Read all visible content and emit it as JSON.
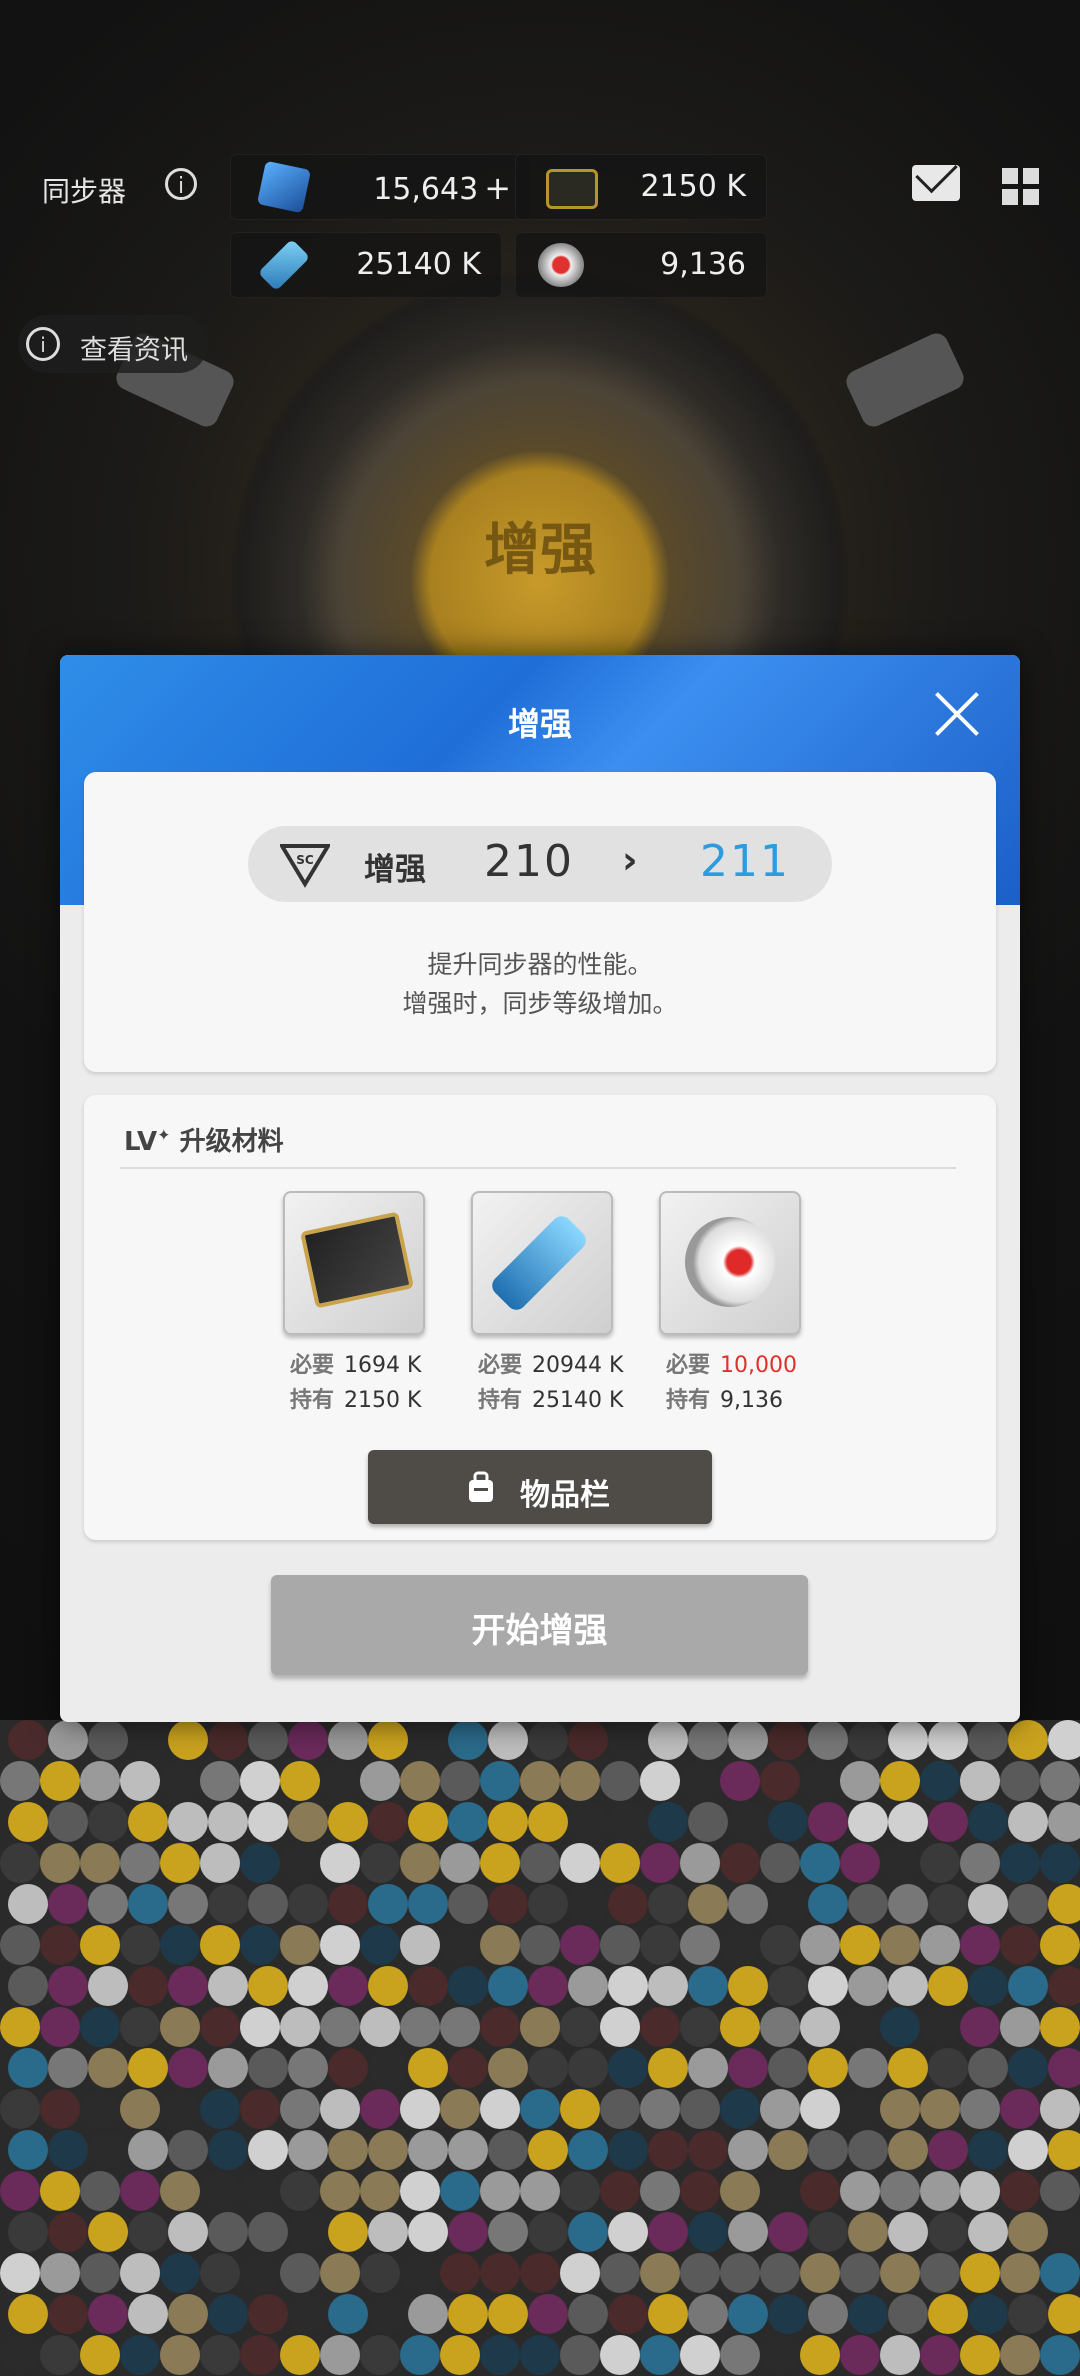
{
  "topbar": {
    "title": "同步器",
    "resources": [
      {
        "icon": "crystal-icon",
        "value": "15,643",
        "has_plus": true
      },
      {
        "icon": "core-card-icon",
        "value": "2150 K"
      },
      {
        "icon": "usb-drive-icon",
        "value": "25140 K"
      },
      {
        "icon": "module-orb-icon",
        "value": "9,136"
      }
    ],
    "info_label": "查看资讯"
  },
  "background": {
    "machine_label": "增强"
  },
  "dialog": {
    "title": "增强",
    "level": {
      "badge": "SC",
      "label": "增强",
      "from": "210",
      "arrow": "›",
      "to": "211"
    },
    "description": [
      "提升同步器的性能。",
      "增强时，同步等级增加。"
    ],
    "materials": {
      "section_title": "升级材料",
      "section_prefix": "LV",
      "items": [
        {
          "icon": "black-gold-card-icon",
          "required_label": "必要",
          "required": "1694 K",
          "owned_label": "持有",
          "owned": "2150 K",
          "insufficient": false
        },
        {
          "icon": "blue-usb-drive-icon",
          "required_label": "必要",
          "required": "20944 K",
          "owned_label": "持有",
          "owned": "25140 K",
          "insufficient": false
        },
        {
          "icon": "red-eye-orb-icon",
          "required_label": "必要",
          "required": "10,000",
          "owned_label": "持有",
          "owned": "9,136",
          "insufficient": true
        }
      ]
    },
    "inventory_button": "物品栏",
    "start_button": "开始增强"
  },
  "colors": {
    "header_blue": "#2f8ee8",
    "level_to": "#2d9be0",
    "insufficient": "#e0302b",
    "start_button_disabled": "#a9a9a9"
  }
}
